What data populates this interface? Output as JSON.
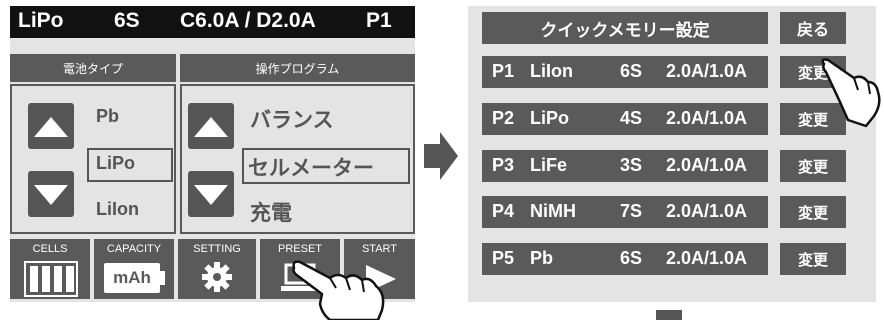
{
  "left_screen": {
    "status": {
      "chem": "LiPo",
      "cells": "6S",
      "current": "C6.0A / D2.0A",
      "preset": "P1"
    },
    "battery_type": {
      "header": "電池タイプ",
      "options": [
        "Pb",
        "LiPo",
        "LiIon"
      ],
      "selected": "LiPo"
    },
    "program": {
      "header": "操作プログラム",
      "options": [
        "バランス",
        "セルメーター",
        "充電"
      ],
      "selected": "セルメーター"
    },
    "footer": {
      "cells": "CELLS",
      "capacity": "CAPACITY",
      "capacity_unit": "mAh",
      "setting": "SETTING",
      "preset": "PRESET",
      "start": "START"
    }
  },
  "right_screen": {
    "title": "クイックメモリー設定",
    "back": "戻る",
    "presets": [
      {
        "id": "P1",
        "chem": "LiIon",
        "cells": "6S",
        "current": "2.0A/1.0A",
        "action": "変更"
      },
      {
        "id": "P2",
        "chem": "LiPo",
        "cells": "4S",
        "current": "2.0A/1.0A",
        "action": "変更"
      },
      {
        "id": "P3",
        "chem": "LiFe",
        "cells": "3S",
        "current": "2.0A/1.0A",
        "action": "変更"
      },
      {
        "id": "P4",
        "chem": "NiMH",
        "cells": "7S",
        "current": "2.0A/1.0A",
        "action": "変更"
      },
      {
        "id": "P5",
        "chem": "Pb",
        "cells": "6S",
        "current": "2.0A/1.0A",
        "action": "変更"
      }
    ]
  },
  "colors": {
    "panel": "#e4e4e4",
    "dark": "#5a5a5a",
    "status_bar": "#111111",
    "text_gray": "#555555"
  },
  "icons": [
    "battery-icon",
    "gear-icon",
    "laptop-icon",
    "play-icon",
    "up-arrow-icon",
    "down-arrow-icon",
    "pointing-hand-icon",
    "right-arrow-icon"
  ]
}
